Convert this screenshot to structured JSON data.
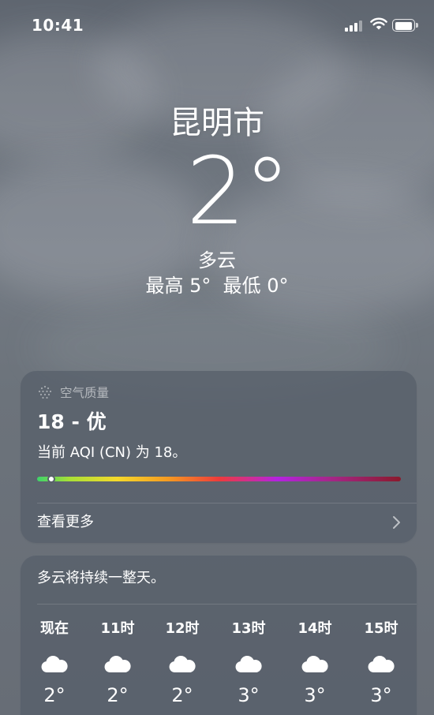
{
  "status_bar": {
    "time": "10:41"
  },
  "header": {
    "city": "昆明市",
    "temperature": "2°",
    "condition": "多云",
    "high_low": "最高 5°  最低 0°"
  },
  "air_quality": {
    "title": "空气质量",
    "value": "18 - 优",
    "description": "当前 AQI (CN) 为 18。",
    "aqi": 18,
    "more_label": "查看更多"
  },
  "hourly": {
    "summary": "多云将持续一整天。",
    "items": [
      {
        "time": "现在",
        "icon": "cloud-icon",
        "temp": "2°"
      },
      {
        "time": "11时",
        "icon": "cloud-icon",
        "temp": "2°"
      },
      {
        "time": "12时",
        "icon": "cloud-icon",
        "temp": "2°"
      },
      {
        "time": "13时",
        "icon": "cloud-icon",
        "temp": "3°"
      },
      {
        "time": "14时",
        "icon": "cloud-icon",
        "temp": "3°"
      },
      {
        "time": "15时",
        "icon": "cloud-icon",
        "temp": "3°"
      }
    ]
  }
}
